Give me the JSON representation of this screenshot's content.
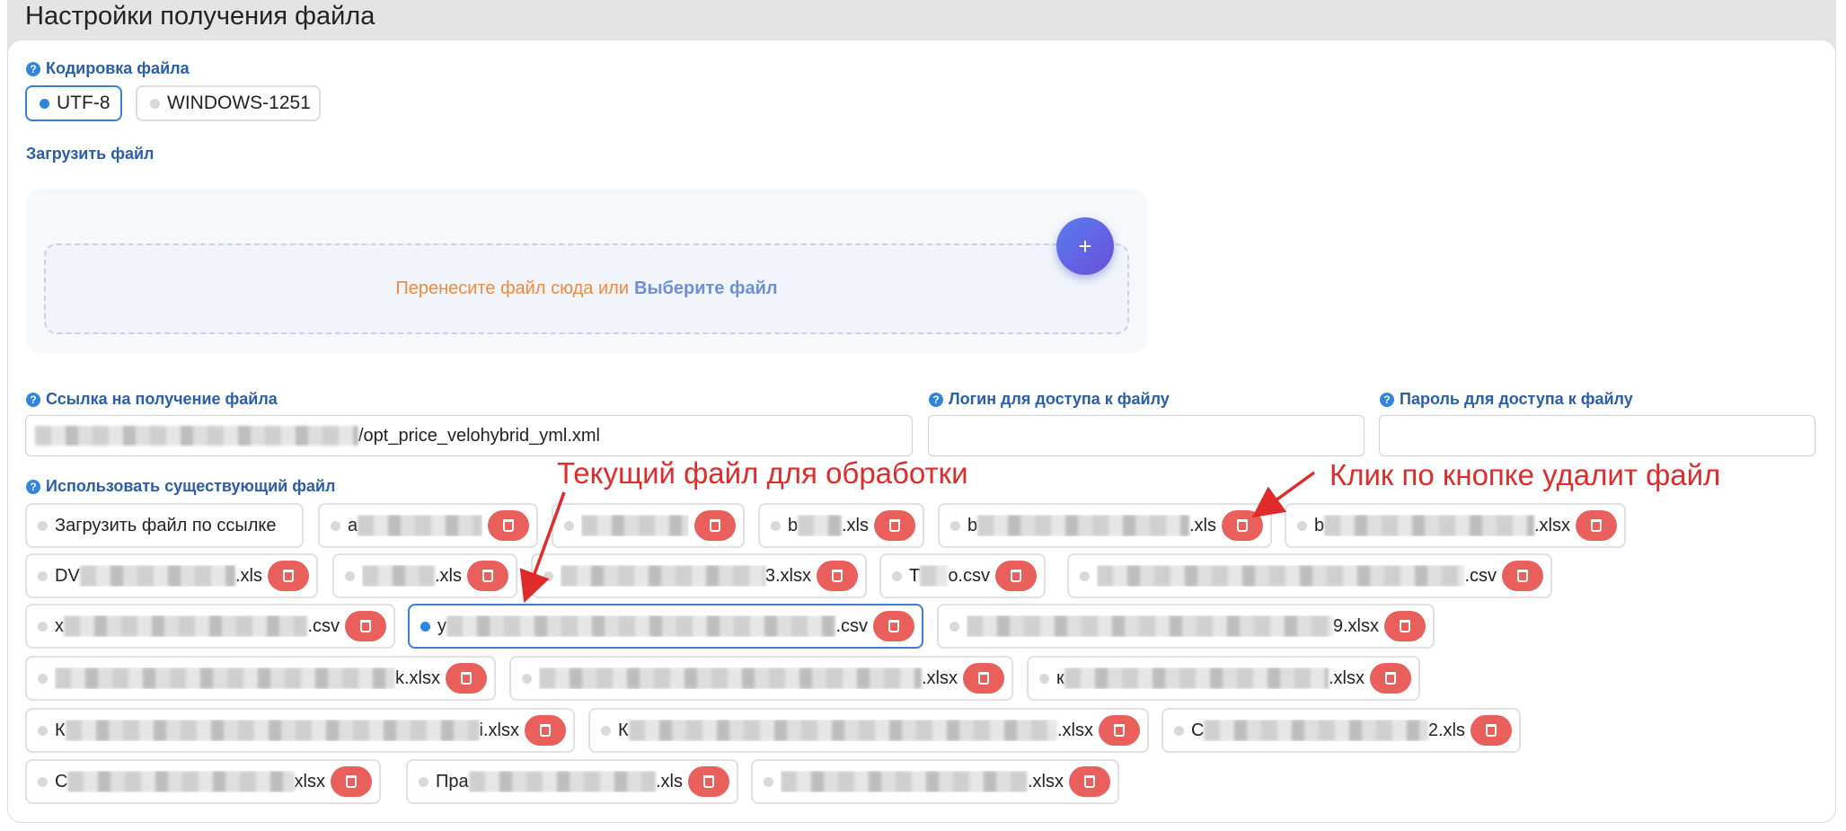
{
  "header": {
    "title": "Настройки получения файла"
  },
  "encoding": {
    "label": "Кодировка файла",
    "options": [
      {
        "label": "UTF-8",
        "selected": true
      },
      {
        "label": "WINDOWS-1251",
        "selected": false
      }
    ]
  },
  "upload": {
    "label": "Загрузить файл",
    "drop_text": "Перенесите файл сюда или",
    "drop_link": "Выберите файл",
    "plus": "+"
  },
  "url_field": {
    "label": "Ссылка на получение файла",
    "value_suffix": "/opt_price_velohybrid_yml.xml"
  },
  "login_field": {
    "label": "Логин для доступа к файлу",
    "value": ""
  },
  "password_field": {
    "label": "Пароль для доступа к файлу",
    "value": ""
  },
  "existing": {
    "label": "Использовать существующий файл",
    "load_by_link": "Загрузить файл по ссылке",
    "files": [
      {
        "prefix": "a",
        "suffix": "",
        "active": false
      },
      {
        "prefix": "",
        "suffix": "",
        "active": false
      },
      {
        "prefix": "b",
        "suffix": ".xls",
        "active": false
      },
      {
        "prefix": "b",
        "suffix": ".xls",
        "active": false
      },
      {
        "prefix": "b",
        "suffix": ".xlsx",
        "active": false
      },
      {
        "prefix": "DV",
        "suffix": ".xls",
        "active": false
      },
      {
        "prefix": "",
        "suffix": ".xls",
        "active": false
      },
      {
        "prefix": "",
        "suffix": "3.xlsx",
        "active": false
      },
      {
        "prefix": "T",
        "suffix": "o.csv",
        "active": false
      },
      {
        "prefix": "",
        "suffix": ".csv",
        "active": false
      },
      {
        "prefix": "x",
        "suffix": ".csv",
        "active": false
      },
      {
        "prefix": "y",
        "suffix": ".csv",
        "active": true
      },
      {
        "prefix": "",
        "suffix": "9.xlsx",
        "active": false
      },
      {
        "prefix": "",
        "suffix": "k.xlsx",
        "active": false
      },
      {
        "prefix": "",
        "suffix": ".xlsx",
        "active": false
      },
      {
        "prefix": "к",
        "suffix": ".xlsx",
        "active": false
      },
      {
        "prefix": "К",
        "suffix": "i.xlsx",
        "active": false
      },
      {
        "prefix": "К",
        "suffix": ".xlsx",
        "active": false
      },
      {
        "prefix": "С",
        "suffix": "2.xls",
        "active": false
      },
      {
        "prefix": "С",
        "suffix": "xlsx",
        "active": false
      },
      {
        "prefix": "Пра",
        "suffix": ".xls",
        "active": false
      },
      {
        "prefix": "",
        "suffix": ".xlsx",
        "active": false
      }
    ]
  },
  "annotations": {
    "current": "Текущий файл для обработки",
    "delete": "Клик по кнопке удалит файл"
  },
  "colors": {
    "accent": "#2e86de",
    "label": "#2a5ea8",
    "delete": "#e85f5c",
    "annotation": "#e02b2b",
    "drop_text": "#f08a3c"
  }
}
